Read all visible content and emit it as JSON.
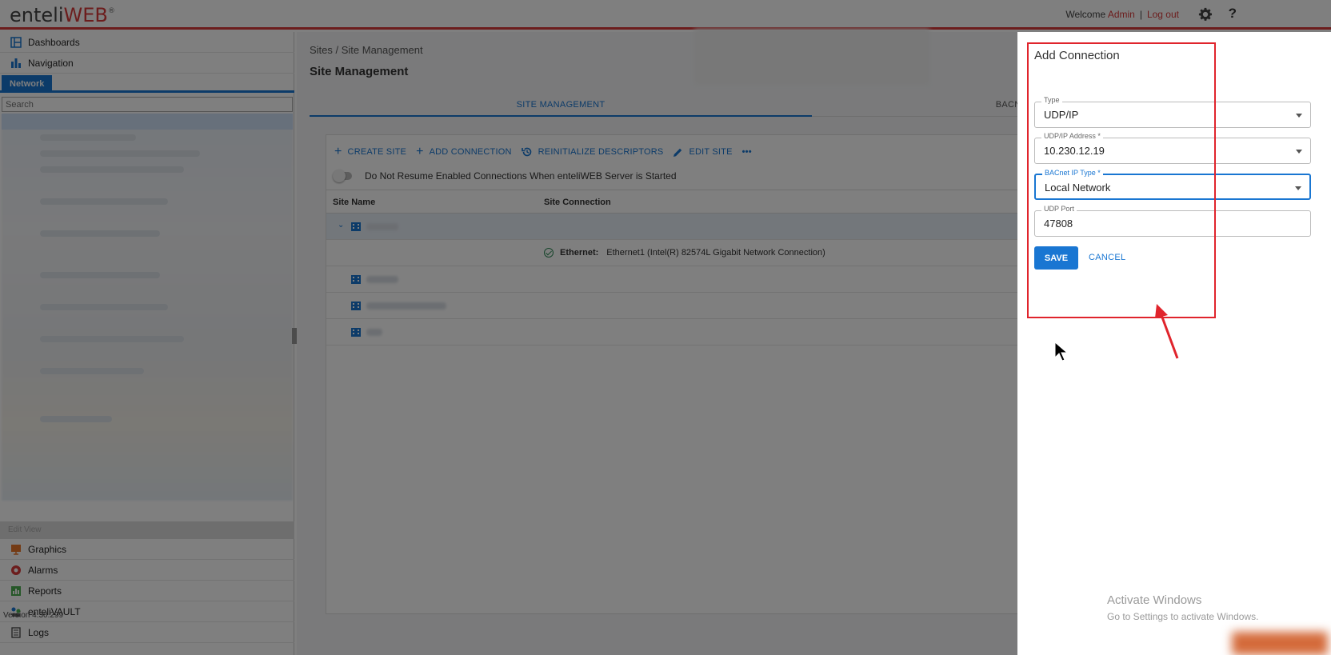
{
  "header": {
    "logo_text": "enteli",
    "logo_web": "WEB",
    "logo_reg": "®",
    "welcome": "Welcome",
    "user": "Admin",
    "separator": "|",
    "logout": "Log out",
    "help": "?"
  },
  "sidebar": {
    "top_items": [
      {
        "label": "Dashboards",
        "icon": "dashboard-icon"
      },
      {
        "label": "Navigation",
        "icon": "navigation-icon"
      }
    ],
    "network_tab": "Network",
    "search_placeholder": "Search",
    "edit_view": "Edit View",
    "bottom_items": [
      {
        "label": "Graphics",
        "icon": "graphics-icon"
      },
      {
        "label": "Alarms",
        "icon": "alarm-icon"
      },
      {
        "label": "Reports",
        "icon": "reports-icon"
      },
      {
        "label": "enteliVAULT",
        "icon": "vault-icon"
      },
      {
        "label": "Logs",
        "icon": "logs-icon"
      }
    ],
    "version": "Version 4.30.299"
  },
  "main": {
    "breadcrumb": "Sites  /  Site Management",
    "title": "Site Management",
    "tabs": [
      "SITE MANAGEMENT",
      "BACNET SI"
    ],
    "toolbar": {
      "create_site": "CREATE SITE",
      "add_connection": "ADD CONNECTION",
      "reinitialize": "REINITIALIZE DESCRIPTORS",
      "edit_site": "EDIT SITE",
      "more": "•••"
    },
    "toggle_label": "Do Not Resume Enabled Connections When enteliWEB Server is Started",
    "columns": {
      "site_name": "Site Name",
      "site_connection": "Site Connection"
    },
    "connection": {
      "label": "Ethernet:",
      "value": "Ethernet1 (Intel(R) 82574L Gigabit Network Connection)"
    }
  },
  "drawer": {
    "title": "Add Connection",
    "fields": {
      "type": {
        "label": "Type",
        "value": "UDP/IP"
      },
      "address": {
        "label": "UDP/IP Address *",
        "value": "10.230.12.19"
      },
      "ip_type": {
        "label": "BACnet IP Type *",
        "value": "Local Network"
      },
      "port": {
        "label": "UDP Port",
        "value": "47808"
      }
    },
    "save": "SAVE",
    "cancel": "CANCEL"
  },
  "watermark": {
    "line1": "Activate Windows",
    "line2": "Go to Settings to activate Windows."
  },
  "colors": {
    "accent": "#1976d2",
    "brand_red": "#d93a3a",
    "annotation_red": "#e0242c"
  }
}
